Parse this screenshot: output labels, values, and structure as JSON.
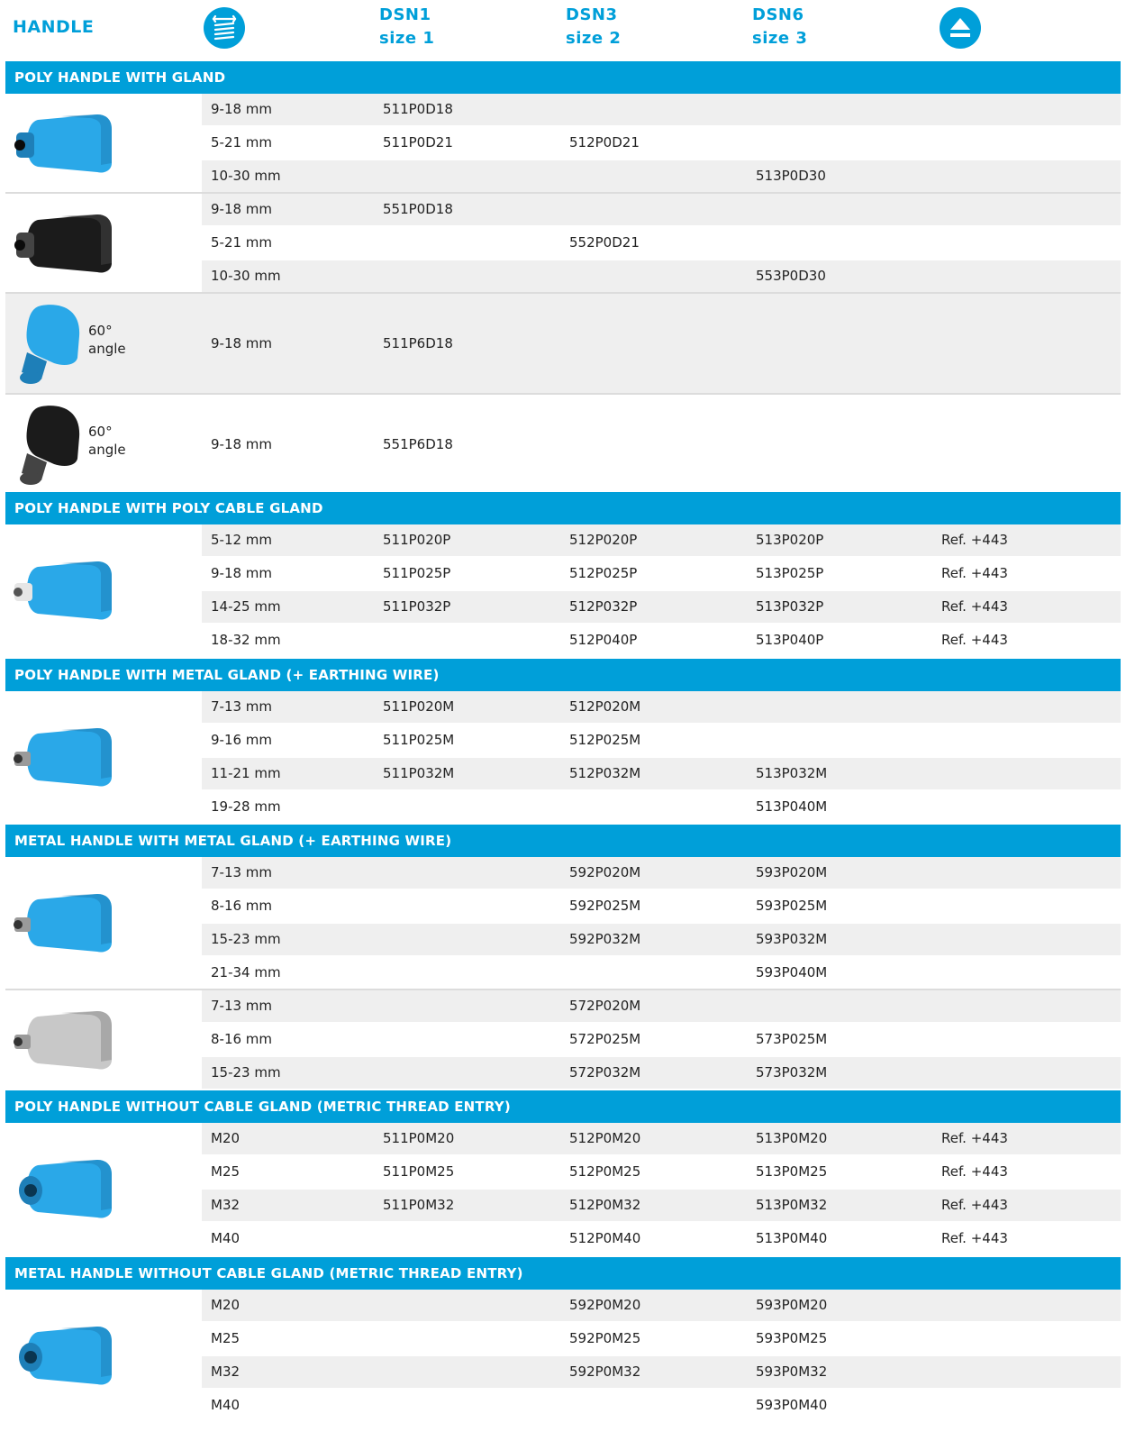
{
  "header": {
    "col_handle": "HANDLE",
    "dsn1": "DSN1",
    "dsn1_size": "size 1",
    "dsn3": "DSN3",
    "dsn3_size": "size 2",
    "dsn6": "DSN6",
    "dsn6_size": "size 3",
    "icon_left": "cable-range-icon",
    "icon_right": "eject-icon",
    "brand_color": "#009fd9"
  },
  "sections": [
    {
      "title": "POLY HANDLE WITH GLAND",
      "groups": [
        {
          "product": "blue-straight-handle",
          "label": "",
          "rows": [
            [
              "9-18 mm",
              "511P0D18",
              "",
              "",
              ""
            ],
            [
              "5-21 mm",
              "511P0D21",
              "512P0D21",
              "",
              ""
            ],
            [
              "10-30 mm",
              "",
              "",
              "513P0D30",
              ""
            ]
          ]
        },
        {
          "product": "black-straight-handle",
          "label": "",
          "rows": [
            [
              "9-18 mm",
              "551P0D18",
              "",
              "",
              ""
            ],
            [
              "5-21 mm",
              "",
              "552P0D21",
              "",
              ""
            ],
            [
              "10-30 mm",
              "",
              "",
              "553P0D30",
              ""
            ]
          ]
        },
        {
          "product": "blue-angled-handle",
          "label": "60° angle",
          "rows": [
            [
              "9-18 mm",
              "511P6D18",
              "",
              "",
              ""
            ]
          ]
        },
        {
          "product": "black-angled-handle",
          "label": "60° angle",
          "rows": [
            [
              "9-18 mm",
              "551P6D18",
              "",
              "",
              ""
            ]
          ]
        }
      ]
    },
    {
      "title": "POLY HANDLE WITH POLY CABLE GLAND",
      "groups": [
        {
          "product": "blue-poly-gland-handle",
          "label": "",
          "rows": [
            [
              "5-12 mm",
              "511P020P",
              "512P020P",
              "513P020P",
              "Ref. +443"
            ],
            [
              "9-18 mm",
              "511P025P",
              "512P025P",
              "513P025P",
              "Ref. +443"
            ],
            [
              "14-25 mm",
              "511P032P",
              "512P032P",
              "513P032P",
              "Ref. +443"
            ],
            [
              "18-32 mm",
              "",
              "512P040P",
              "513P040P",
              "Ref. +443"
            ]
          ]
        }
      ]
    },
    {
      "title": "POLY HANDLE WITH METAL GLAND (+ EARTHING WIRE)",
      "groups": [
        {
          "product": "blue-metal-gland-handle",
          "label": "",
          "rows": [
            [
              "7-13 mm",
              "511P020M",
              "512P020M",
              "",
              ""
            ],
            [
              "9-16 mm",
              "511P025M",
              "512P025M",
              "",
              ""
            ],
            [
              "11-21 mm",
              "511P032M",
              "512P032M",
              "513P032M",
              ""
            ],
            [
              "19-28 mm",
              "",
              "",
              "513P040M",
              ""
            ]
          ]
        }
      ]
    },
    {
      "title": "METAL HANDLE WITH METAL GLAND (+ EARTHING WIRE)",
      "groups": [
        {
          "product": "blue-metal-gland-handle",
          "label": "",
          "rows": [
            [
              "7-13 mm",
              "",
              "592P020M",
              "593P020M",
              ""
            ],
            [
              "8-16 mm",
              "",
              "592P025M",
              "593P025M",
              ""
            ],
            [
              "15-23 mm",
              "",
              "592P032M",
              "593P032M",
              ""
            ],
            [
              "21-34 mm",
              "",
              "",
              "593P040M",
              ""
            ]
          ]
        },
        {
          "product": "grey-metal-handle",
          "label": "",
          "rows": [
            [
              "7-13 mm",
              "",
              "572P020M",
              "",
              ""
            ],
            [
              "8-16 mm",
              "",
              "572P025M",
              "573P025M",
              ""
            ],
            [
              "15-23 mm",
              "",
              "572P032M",
              "573P032M",
              ""
            ]
          ]
        }
      ]
    },
    {
      "title": "POLY HANDLE WITHOUT CABLE GLAND (METRIC THREAD ENTRY)",
      "groups": [
        {
          "product": "blue-thread-entry-handle",
          "label": "",
          "rows": [
            [
              "M20",
              "511P0M20",
              "512P0M20",
              "513P0M20",
              "Ref. +443"
            ],
            [
              "M25",
              "511P0M25",
              "512P0M25",
              "513P0M25",
              "Ref. +443"
            ],
            [
              "M32",
              "511P0M32",
              "512P0M32",
              "513P0M32",
              "Ref. +443"
            ],
            [
              "M40",
              "",
              "512P0M40",
              "513P0M40",
              "Ref. +443"
            ]
          ]
        }
      ]
    },
    {
      "title": "METAL HANDLE WITHOUT CABLE GLAND (METRIC THREAD ENTRY)",
      "groups": [
        {
          "product": "blue-thread-entry-handle",
          "label": "",
          "rows": [
            [
              "M20",
              "",
              "592P0M20",
              "593P0M20",
              ""
            ],
            [
              "M25",
              "",
              "592P0M25",
              "593P0M25",
              ""
            ],
            [
              "M32",
              "",
              "592P0M32",
              "593P0M32",
              ""
            ],
            [
              "M40",
              "",
              "",
              "593P0M40",
              ""
            ]
          ]
        }
      ]
    }
  ]
}
